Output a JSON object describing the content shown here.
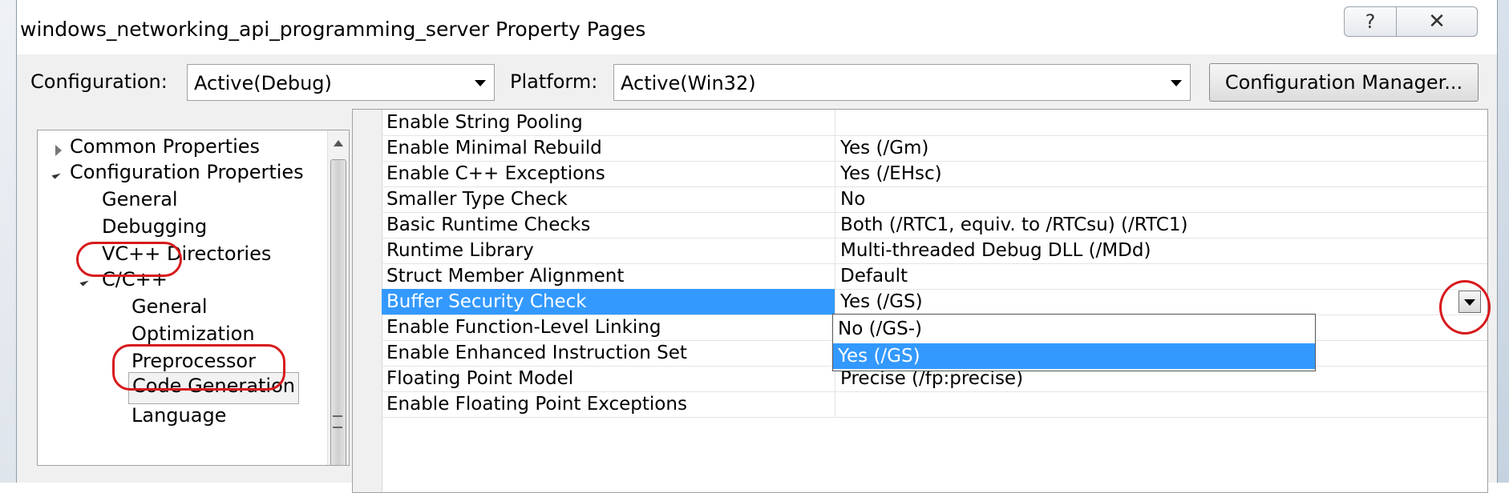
{
  "window": {
    "title": "windows_networking_api_programming_server Property Pages",
    "help_glyph": "?",
    "close_glyph": "✕"
  },
  "toolbar": {
    "configuration_label": "Configuration:",
    "configuration_value": "Active(Debug)",
    "platform_label": "Platform:",
    "platform_value": "Active(Win32)",
    "config_manager_label": "Configuration Manager..."
  },
  "tree": {
    "items": [
      {
        "label": "Common Properties"
      },
      {
        "label": "Configuration Properties"
      },
      {
        "label": "General"
      },
      {
        "label": "Debugging"
      },
      {
        "label": "VC++ Directories"
      },
      {
        "label": "C/C++"
      },
      {
        "label": "General"
      },
      {
        "label": "Optimization"
      },
      {
        "label": "Preprocessor"
      },
      {
        "label": "Code Generation"
      },
      {
        "label": "Language"
      }
    ]
  },
  "properties": {
    "rows": [
      {
        "name": "Enable String Pooling",
        "value": ""
      },
      {
        "name": "Enable Minimal Rebuild",
        "value": "Yes (/Gm)"
      },
      {
        "name": "Enable C++ Exceptions",
        "value": "Yes (/EHsc)"
      },
      {
        "name": "Smaller Type Check",
        "value": "No"
      },
      {
        "name": "Basic Runtime Checks",
        "value": "Both (/RTC1, equiv. to /RTCsu) (/RTC1)"
      },
      {
        "name": "Runtime Library",
        "value": "Multi-threaded Debug DLL (/MDd)"
      },
      {
        "name": "Struct Member Alignment",
        "value": "Default"
      },
      {
        "name": "Buffer Security Check",
        "value": "Yes (/GS)"
      },
      {
        "name": "Enable Function-Level Linking",
        "value": ""
      },
      {
        "name": "Enable Enhanced Instruction Set",
        "value": ""
      },
      {
        "name": "Floating Point Model",
        "value": "Precise (/fp:precise)"
      },
      {
        "name": "Enable Floating Point Exceptions",
        "value": ""
      }
    ],
    "selected_row": "Buffer Security Check"
  },
  "dropdown": {
    "options": [
      {
        "label": "No (/GS-)"
      },
      {
        "label": "Yes (/GS)"
      }
    ],
    "selected": "Yes (/GS)"
  },
  "colors": {
    "selection": "#3399ff",
    "annotation": "#d7191c"
  },
  "icons": {
    "expand_collapsed": "triangle-right-icon",
    "expand_expanded": "triangle-down-icon",
    "dropdown": "chevron-down-icon",
    "help": "help-icon",
    "close": "close-icon"
  }
}
